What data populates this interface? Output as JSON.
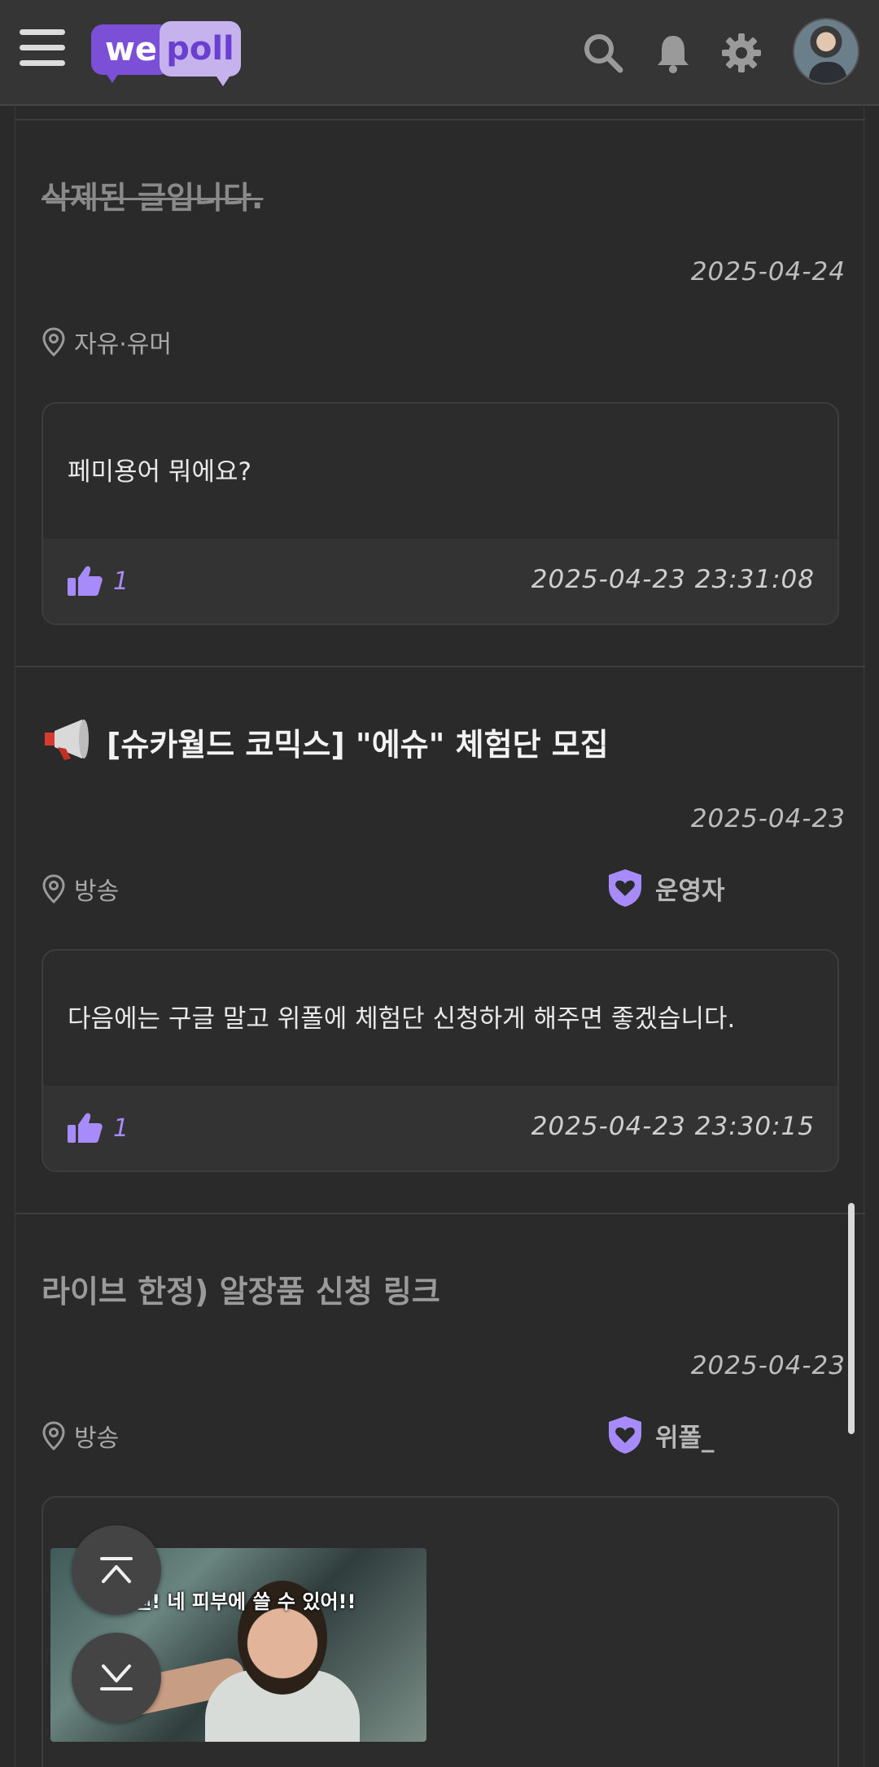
{
  "header": {
    "logo_we": "we",
    "logo_poll": "poll",
    "icons": [
      "menu-icon",
      "search-icon",
      "bell-icon",
      "gear-icon"
    ]
  },
  "posts": [
    {
      "title": "삭제된 글입니다.",
      "date": "2025-04-24",
      "category": "자유·유머",
      "author": "",
      "comment": {
        "text": "페미용어 뭐에요?",
        "likes": "1",
        "time": "2025-04-23 23:31:08"
      }
    },
    {
      "title_icon": "megaphone-icon",
      "title": "[슈카월드 코믹스] \"에슈\" 체험단 모집",
      "date": "2025-04-23",
      "category": "방송",
      "author": "운영자",
      "comment": {
        "text": "다음에는 구글 말고 위폴에 체험단 신청하게 해주면 좋겠습니다.",
        "likes": "1",
        "time": "2025-04-23 23:30:15"
      }
    },
    {
      "title": "라이브 한정) 알장품 신청 링크",
      "date": "2025-04-23",
      "category": "방송",
      "author": "위폴_",
      "image_caption": "라겐! 네 피부에 쓸 수 있어!!"
    }
  ],
  "colors": {
    "accent": "#a78bfa",
    "brand_purple": "#7b4fd6",
    "background": "#2a2a2a"
  }
}
